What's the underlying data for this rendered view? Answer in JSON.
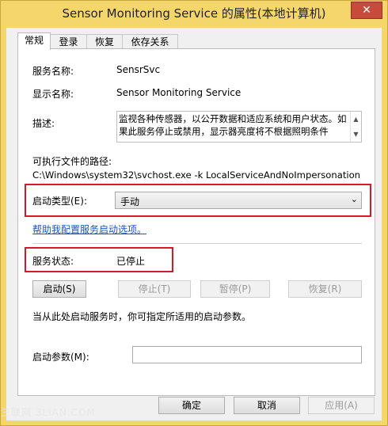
{
  "window": {
    "title": "Sensor Monitoring Service 的属性(本地计算机)",
    "close_glyph": "✕"
  },
  "tabs": [
    "常规",
    "登录",
    "恢复",
    "依存关系"
  ],
  "general": {
    "service_name_label": "服务名称:",
    "service_name_value": "SensrSvc",
    "display_name_label": "显示名称:",
    "display_name_value": "Sensor Monitoring Service",
    "description_label": "描述:",
    "description_value": "监视各种传感器，以公开数据和适应系统和用户状态。如果此服务停止或禁用，显示器亮度将不根据照明条件",
    "exe_path_label": "可执行文件的路径:",
    "exe_path_value": "C:\\Windows\\system32\\svchost.exe -k LocalServiceAndNoImpersonation",
    "startup_type_label": "启动类型(E):",
    "startup_type_value": "手动",
    "help_link": "帮助我配置服务启动选项。",
    "status_label": "服务状态:",
    "status_value": "已停止",
    "buttons": {
      "start": "启动(S)",
      "stop": "停止(T)",
      "pause": "暂停(P)",
      "resume": "恢复(R)"
    },
    "hint": "当从此处启动服务时，你可指定所适用的启动参数。",
    "start_params_label": "启动参数(M):",
    "start_params_value": ""
  },
  "footer": {
    "ok": "确定",
    "cancel": "取消",
    "apply": "应用(A)"
  },
  "watermark": "三联网 3LIAN.COM",
  "colors": {
    "accent": "#f5d66b",
    "highlight": "#d6182b",
    "link": "#1a55c4"
  }
}
